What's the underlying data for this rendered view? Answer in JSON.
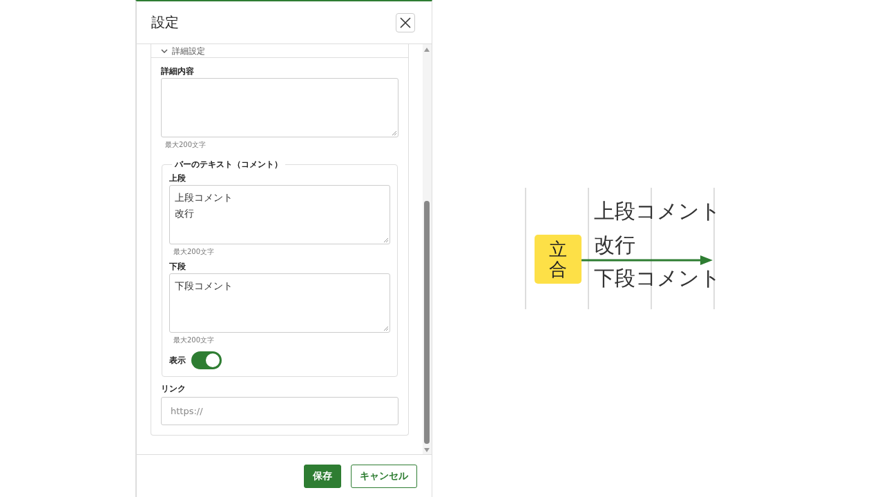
{
  "dialog": {
    "title": "設定",
    "section": {
      "title": "詳細設定",
      "expanded": true
    },
    "detail": {
      "label": "詳細内容",
      "hint": "最大200文字"
    },
    "bar_text": {
      "legend": "バーのテキスト（コメント）",
      "fields": [
        {
          "label": "上段",
          "lines": [
            "上段コメント",
            "改行"
          ],
          "hint": "最大200文字"
        },
        {
          "label": "下段",
          "lines": [
            "下段コメント"
          ],
          "hint": "最大200文字"
        }
      ],
      "toggle": {
        "label": "表示",
        "on": true
      }
    },
    "link": {
      "label": "リンク",
      "placeholder": "https://"
    },
    "buttons": [
      {
        "label": "保存",
        "kind": "primary"
      },
      {
        "label": "キャンセル",
        "kind": "secondary"
      }
    ]
  },
  "preview": {
    "badge": "立合",
    "upper_lines": [
      "上段コメント",
      "改行"
    ],
    "lower": "下段コメント"
  }
}
